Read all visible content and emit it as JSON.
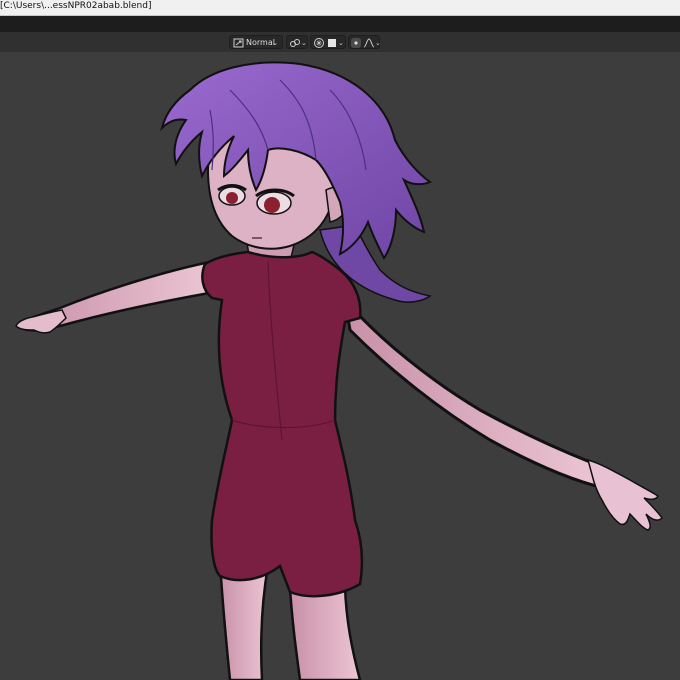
{
  "window": {
    "title": "[C:\\Users\\...essNPR02abab.blend]"
  },
  "header": {
    "transform_pivot": {
      "value": "Normal",
      "icon": "pivot-icon"
    },
    "snap": {
      "icon": "snap-link-icon"
    },
    "shading": {
      "icons": [
        "viewport-shading-icon",
        "color-swatch-icon"
      ]
    },
    "proportional": {
      "icons": [
        "proportional-dot-icon",
        "falloff-curve-icon"
      ]
    }
  },
  "viewport": {
    "background": "#3d3d3d",
    "subject": "toon-shaded character in T-pose",
    "colors": {
      "hair": "#8a5cc0",
      "skin": "#d9a6b8",
      "suit": "#7a1f42",
      "outline": "#111111",
      "eyes": "#8a2030"
    }
  }
}
